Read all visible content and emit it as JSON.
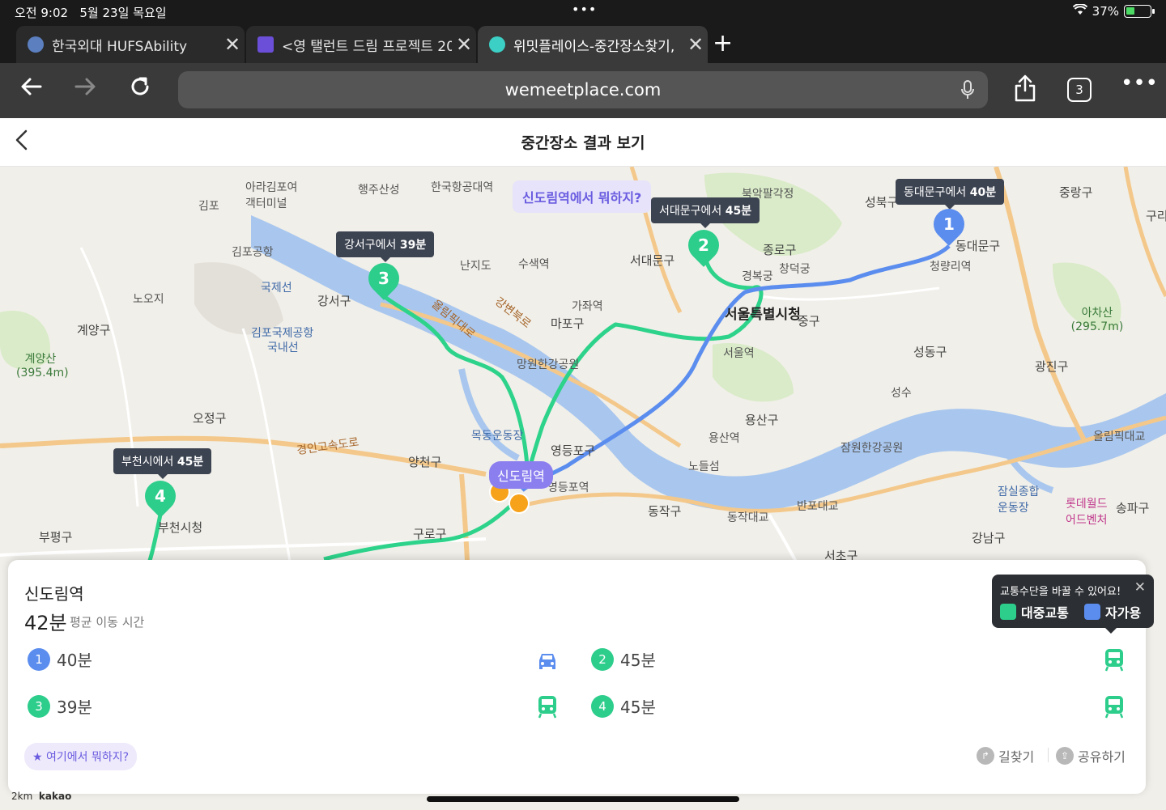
{
  "status": {
    "time": "오전 9:02",
    "date": "5월 23일 목요일",
    "battery": "37%",
    "battery_level": 0.37
  },
  "tabs": [
    {
      "label": "한국외대 HUFSAbility",
      "favicon_color": "#5b7fbf",
      "active": false
    },
    {
      "label": "<영 탤런트 드림 프로젝트 20",
      "favicon_color": "#6b4fd8",
      "active": false
    },
    {
      "label": "위밋플레이스-중간장소찾기,",
      "favicon_color": "#3ccfc5",
      "active": true
    }
  ],
  "toolbar": {
    "url": "wemeetplace.com",
    "tab_count": "3"
  },
  "page": {
    "title": "중간장소 결과 보기"
  },
  "map": {
    "whatdo_bubble": "신도림역에서 뭐하지?",
    "center_station": "신도림역",
    "callouts": [
      {
        "prefix": "동대문구에서 ",
        "time": "40분"
      },
      {
        "prefix": "서대문구에서 ",
        "time": "45분"
      },
      {
        "prefix": "강서구에서 ",
        "time": "39분"
      },
      {
        "prefix": "부천시에서 ",
        "time": "45분"
      }
    ],
    "pins": [
      "1",
      "2",
      "3",
      "4"
    ],
    "labels": {
      "gangseo": "강서구",
      "mapo": "마포구",
      "seodaemun": "서대문구",
      "jongno": "종로구",
      "seoul_city": "서울특별시청",
      "jung": "중구",
      "seongdong": "성동구",
      "gwangjin": "광진구",
      "yongsan": "용산구",
      "yeongdeungpo": "영등포구",
      "yangcheon": "양천구",
      "guro": "구로구",
      "dongjak": "동작구",
      "gangnam": "강남구",
      "seocho": "서초구",
      "songpa": "송파구",
      "gyeyang": "계양구",
      "ojeong": "오정구",
      "bupyeong": "부평구",
      "bucheon_city": "부천시청",
      "dongdaemun": "동대문구",
      "seongbuk": "성북구",
      "jungnang": "중랑구",
      "guri": "구리",
      "gimpo_airport": "김포국제공항",
      "gimpo_domestic": "국내선",
      "gimpo_intl": "국제선",
      "haengju": "행주산성",
      "nanjido": "난지도",
      "susaek": "수색역",
      "gajwa": "가좌역",
      "mangwon": "망원한강공원",
      "mokdong": "목동운동장",
      "yeongdeungpo_st": "영등포역",
      "noryangjin": "노들섬",
      "seoul_station": "서울역",
      "yongsan_st": "용산역",
      "jamwon": "잠원한강공원",
      "jamsil": "잠실종합운동장",
      "lotte": "롯데월드어드벤처",
      "cheongnyangni": "청량리역",
      "gyeongbok": "경복궁",
      "changdeok": "창덕궁",
      "achasan": "아차산(295.7m)",
      "gyeyangsan": "계양산(395.4m)",
      "olympic": "올림픽대로",
      "gangbyeon": "강변북로",
      "gyeongin": "경인고속도로",
      "bukak": "북악팔각정",
      "hanguk_aviation": "한국항공대역",
      "arakimpo": "아라김포여객터미널",
      "seongsu": "성수",
      "banpo": "반포대교",
      "dongjak_bridge": "동작대교",
      "olympic_bridge": "올림픽대교",
      "gimpo_airport_short": "김포공항",
      "noji": "노오지",
      "gimpo": "김포"
    }
  },
  "sheet": {
    "station": "신도림역",
    "avg_time": "42분",
    "avg_label": "평균 이동 시간",
    "rows": [
      {
        "num": "1",
        "time": "40분",
        "mode": "car",
        "color": "blue"
      },
      {
        "num": "2",
        "time": "45분",
        "mode": "transit",
        "color": "green"
      },
      {
        "num": "3",
        "time": "39분",
        "mode": "transit",
        "color": "green"
      },
      {
        "num": "4",
        "time": "45분",
        "mode": "transit",
        "color": "green"
      }
    ],
    "whatdo_button": "여기에서 뭐하지?",
    "directions": "길찾기",
    "share": "공유하기"
  },
  "tooltip": {
    "title": "교통수단을 바꿀 수 있어요!",
    "transit": "대중교통",
    "car": "자가용"
  },
  "scale": "2km",
  "brand": "kakao",
  "colors": {
    "transit_route": "#2dd38a",
    "car_route": "#5b8def",
    "accent": "#6a5ce0",
    "water": "#a9c7ee",
    "park": "#cfe6bd"
  }
}
